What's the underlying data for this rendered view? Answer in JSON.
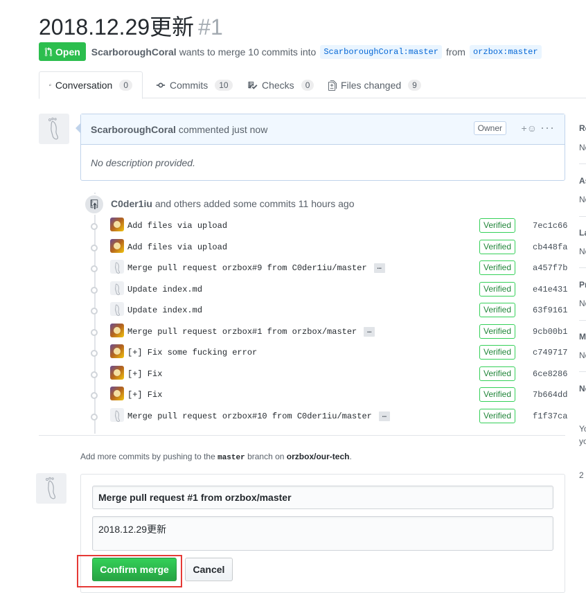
{
  "pr": {
    "title": "2018.12.29更新",
    "number": "#1",
    "state": "Open",
    "author": "ScarboroughCoral",
    "merge_text": "wants to merge 10 commits into",
    "base_branch": "ScarboroughCoral:master",
    "from_text": "from",
    "head_branch": "orzbox:master"
  },
  "tabs": [
    {
      "label": "Conversation",
      "count": "0"
    },
    {
      "label": "Commits",
      "count": "10"
    },
    {
      "label": "Checks",
      "count": "0"
    },
    {
      "label": "Files changed",
      "count": "9"
    }
  ],
  "comment": {
    "author": "ScarboroughCoral",
    "action": "commented just now",
    "badge": "Owner",
    "body": "No description provided."
  },
  "event": {
    "author": "C0der1iu",
    "text": "and others added some commits 11 hours ago"
  },
  "commits": [
    {
      "msg": "Add files via upload",
      "verified": "Verified",
      "sha": "7ec1c66",
      "expand": false,
      "avatar": "color"
    },
    {
      "msg": "Add files via upload",
      "verified": "Verified",
      "sha": "cb448fa",
      "expand": false,
      "avatar": "color"
    },
    {
      "msg": "Merge pull request orzbox#9 from C0der1iu/master",
      "verified": "Verified",
      "sha": "a457f7b",
      "expand": true,
      "avatar": "foot"
    },
    {
      "msg": "Update index.md",
      "verified": "Verified",
      "sha": "e41e431",
      "expand": false,
      "avatar": "foot"
    },
    {
      "msg": "Update index.md",
      "verified": "Verified",
      "sha": "63f9161",
      "expand": false,
      "avatar": "foot"
    },
    {
      "msg": "Merge pull request orzbox#1 from orzbox/master",
      "verified": "Verified",
      "sha": "9cb00b1",
      "expand": true,
      "avatar": "color"
    },
    {
      "msg": "[+] Fix some fucking error",
      "verified": "Verified",
      "sha": "c749717",
      "expand": false,
      "avatar": "color"
    },
    {
      "msg": "[+] Fix",
      "verified": "Verified",
      "sha": "6ce8286",
      "expand": false,
      "avatar": "color"
    },
    {
      "msg": "[+] Fix",
      "verified": "Verified",
      "sha": "7b664dd",
      "expand": false,
      "avatar": "color"
    },
    {
      "msg": "Merge pull request orzbox#10 from C0der1iu/master",
      "verified": "Verified",
      "sha": "f1f37ca",
      "expand": true,
      "avatar": "foot"
    }
  ],
  "expand_label": "…",
  "hint": {
    "prefix": "Add more commits by pushing to the",
    "branch": "master",
    "middle": "branch on",
    "repo": "orzbox/our-tech",
    "suffix": "."
  },
  "merge": {
    "title_value": "Merge pull request #1 from orzbox/master",
    "body_value": "2018.12.29更新",
    "confirm_label": "Confirm merge",
    "cancel_label": "Cancel"
  },
  "sidebar": {
    "items": [
      "Re",
      "No",
      "As",
      "No",
      "La",
      "No",
      "Pr",
      "No",
      "M",
      "No",
      "No",
      "Yo",
      "yo",
      "2"
    ]
  },
  "colors": {
    "open_green": "#2cbe4e",
    "link_blue": "#0366d6",
    "highlight_red": "#e53935"
  }
}
